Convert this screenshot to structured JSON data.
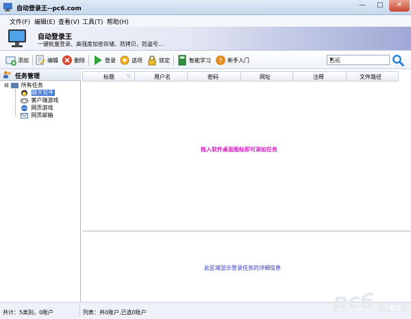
{
  "window": {
    "title": "自动登录王--pc6.com",
    "minimize_glyph": "—",
    "maximize_glyph": "□",
    "close_glyph": "✕"
  },
  "menu": [
    "文件(F)",
    "编辑(E)",
    "查看(V)",
    "工具(T)",
    "帮助(H)"
  ],
  "banner": {
    "title": "自动登录王",
    "subtitle": "一键批量登录、高强度加密存储、防拷贝、防盗号..."
  },
  "toolbar": {
    "add": "添加",
    "edit": "编辑",
    "delete": "删除",
    "login": "登录",
    "options": "选项",
    "lock": "锁定",
    "smart_learn": "智能学习",
    "beginner": "新手入门"
  },
  "search": {
    "value": "百拓",
    "dropdown_glyph": "▼"
  },
  "left_panel": {
    "title": "任务管理",
    "tree": {
      "root": "所有任务",
      "toggle": "⊟",
      "children": [
        "聊天软件",
        "客户端游戏",
        "网页游戏",
        "网页邮箱"
      ]
    }
  },
  "grid": {
    "columns": [
      "标题",
      "用户名",
      "密码",
      "网址",
      "注释",
      "文件路径"
    ],
    "empty_hint": "拖入软件桌面图标即可添加任务"
  },
  "detail": {
    "hint": "此区域显示登录任务的详细信息"
  },
  "status": {
    "left": "共计：5类别，0账户",
    "right": "列表：共0账户,已选0账户"
  },
  "watermark": {
    "text": "pc6",
    "sub": "下载站"
  },
  "colors": {
    "empty_hint": "#d21ec0",
    "detail_hint": "#2d2fd0",
    "selection": "#3a6fd1",
    "banner_right": "#9fa8d6"
  }
}
